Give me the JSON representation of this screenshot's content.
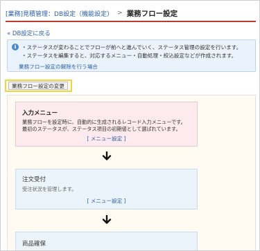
{
  "breadcrumb": {
    "parent": "[業務]見積管理：DB設定（機能設定）",
    "separator": ">",
    "current": "業務フロー設定"
  },
  "back_link": "« DB設定に戻る",
  "info": {
    "icon": "info-icon",
    "line1": "・ステータスが変わることでフローが前へと進んでいく、ステータス管理の設定を行います。",
    "line2": "・ステータスを編集すると、対応するメニュー・自動処理・絞込設定などが作成されます。",
    "cancel_link": "業務フロー設定の解除を行う場合"
  },
  "change_button": "業務フロー設定の変更",
  "flow": {
    "cards": [
      {
        "title": "入力メニュー",
        "desc1": "業務フローを設定時に、自動的に生成されるレコード入力メニューです。",
        "desc2": "最初のステータスが、ステータス項目の初期値として選ばれています。",
        "link": "[ メニュー設定 ]"
      },
      {
        "title": "注文受付",
        "desc1": "受注状況を管理します。",
        "link": "[ メニュー設定 ]"
      },
      {
        "title": "商品確保"
      }
    ],
    "arrow_icon": "arrow-down-icon"
  },
  "colors": {
    "accent_rule": "#c0392b",
    "link": "#2b5ea8",
    "highlight": "#f0d34a"
  }
}
